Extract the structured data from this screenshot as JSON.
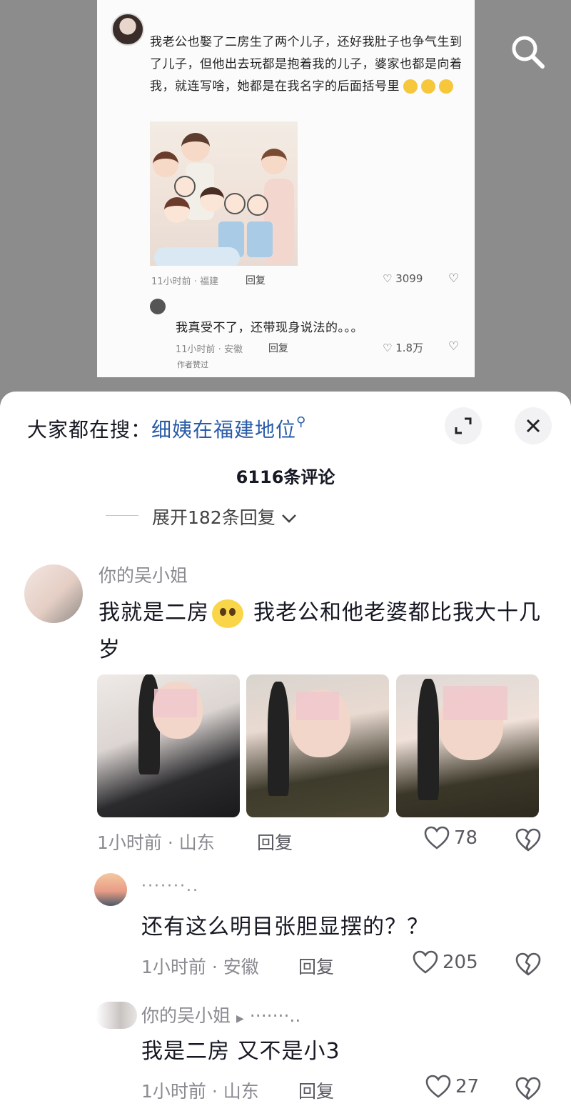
{
  "post_screenshot": {
    "text": "我老公也娶了二房生了两个儿子，还好我肚子也争气生到了儿子，但他出去玩都是抱着我的儿子，婆家也都是向着我，就连写啥，她都是在我名字的后面括号里",
    "meta1": "11小时前 · 福建",
    "reply1": "回复",
    "likes1": "3099",
    "reply_text": "我真受不了，还带现身说法的。。。",
    "meta2": "11小时前 · 安徽",
    "reply2": "回复",
    "likes2": "1.8万",
    "author_liked": "作者赞过"
  },
  "search_bar": {
    "prefix": "大家都在搜：",
    "hint": "细姨在福建地位"
  },
  "comments_header": {
    "count": "6116条评论",
    "expand_label": "展开182条回复"
  },
  "comments": [
    {
      "username": "你的吴小姐",
      "text_part1": "我就是二房",
      "text_part2": "我老公和他老婆都比我大十几岁",
      "meta": "1小时前 · 山东",
      "reply": "回复",
      "likes": "78"
    },
    {
      "username": "·······..",
      "text": "还有这么明目张胆显摆的？？",
      "meta": "1小时前 · 安徽",
      "reply": "回复",
      "likes": "205"
    },
    {
      "username": "你的吴小姐",
      "reply_to": "·······..",
      "text": "我是二房  又不是小3",
      "meta": "1小时前 · 山东",
      "reply": "回复",
      "likes": "27"
    }
  ],
  "icons": {
    "search": "search-icon",
    "expand": "expand-icon",
    "close": "close-icon",
    "like": "heart-icon",
    "dislike": "broken-heart-icon"
  },
  "colors": {
    "hint_blue": "#2a5ca8",
    "meta_gray": "#8a8b91",
    "text_dark": "#161823"
  }
}
